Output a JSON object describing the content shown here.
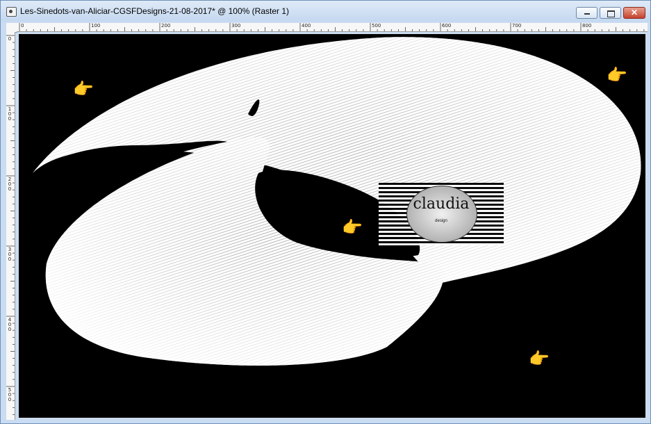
{
  "window": {
    "title": "Les-Sinedots-van-Aliciar-CGSFDesigns-21-08-2017* @ 100% (Raster 1)",
    "icons": {
      "app": "document-icon",
      "minimize": "minimize-icon",
      "maximize": "maximize-icon",
      "close": "close-icon"
    },
    "close_glyph": "✕"
  },
  "ruler": {
    "horizontal_labels": [
      "0",
      "100",
      "200",
      "300",
      "400",
      "500",
      "600",
      "700",
      "800"
    ],
    "vertical_labels": [
      [
        "0"
      ],
      [
        "1",
        "0",
        "0"
      ],
      [
        "2",
        "0",
        "0"
      ],
      [
        "3",
        "0",
        "0"
      ],
      [
        "4",
        "0",
        "0"
      ],
      [
        "5",
        "0",
        "0"
      ]
    ]
  },
  "canvas": {
    "background": "#000000",
    "shape_color": "#ffffff",
    "pointer_glyph": "👉",
    "pointer_icon": "pointing-hand-icon",
    "watermark": {
      "text": "claudia",
      "sub": "design"
    }
  }
}
